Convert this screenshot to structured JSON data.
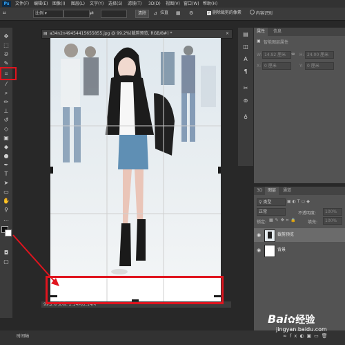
{
  "menu": {
    "logo": "Ps",
    "items": [
      "文件(F)",
      "编辑(E)",
      "图像(I)",
      "图层(L)",
      "文字(Y)",
      "选择(S)",
      "滤镜(T)",
      "3D(D)",
      "视图(V)",
      "窗口(W)",
      "帮助(H)"
    ]
  },
  "options": {
    "ratio": "比例",
    "clear": "清除",
    "straighten": "拉直",
    "delete_cropped": "删除裁剪的像素",
    "content_aware": "内容识别"
  },
  "document": {
    "tab_title": "a34n2n49454415655855.jpg @ 99.2%(裁剪预览, RGB/8#) *",
    "status_text": "99.2%  文档: 2.14M/2.14M"
  },
  "properties": {
    "tabs": [
      "属性",
      "信息"
    ],
    "subtitle": "智能图层属性",
    "w_label": "W:",
    "w_value": "14.92 厘米",
    "h_label": "H:",
    "h_value": "24.00 厘米",
    "x_label": "X:",
    "x_value": "0 厘米",
    "y_label": "Y:",
    "y_value": "0 厘米"
  },
  "layers": {
    "tabs": [
      "3D",
      "图层",
      "通道"
    ],
    "kind_label": "类型",
    "blend_mode": "正常",
    "opacity_label": "不透明度:",
    "opacity_value": "100%",
    "lock_label": "锁定:",
    "fill_label": "填充:",
    "fill_value": "100%",
    "items": [
      {
        "name": "裁剪预览"
      },
      {
        "name": "背景"
      }
    ]
  },
  "bottom": {
    "timeline": "时间轴"
  },
  "watermark": {
    "brand": "Bai",
    "brand_suffix": "经验",
    "url": "jingyan.baidu.com"
  },
  "colors": {
    "annotation": "#e0141e",
    "panel": "#535353"
  }
}
